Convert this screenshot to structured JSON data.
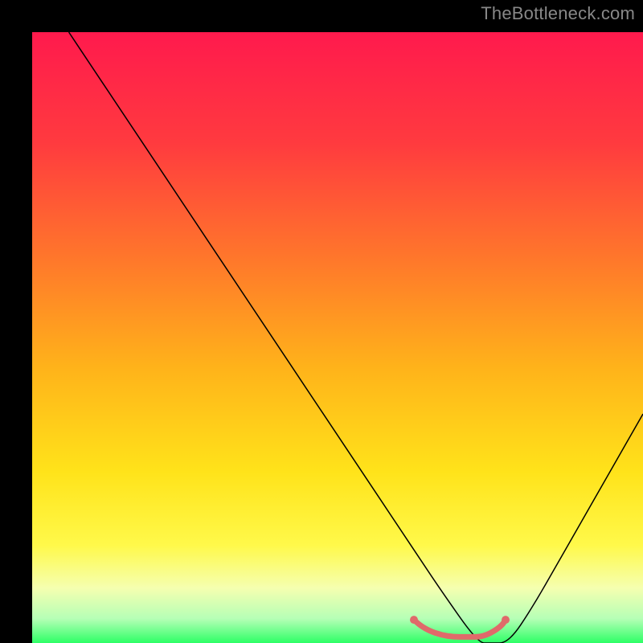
{
  "watermark": "TheBottleneck.com",
  "chart_data": {
    "type": "line",
    "title": "",
    "xlabel": "",
    "ylabel": "",
    "xlim": [
      0,
      100
    ],
    "ylim": [
      0,
      100
    ],
    "grid": false,
    "legend": false,
    "background_gradient_stops": [
      {
        "offset": 0.0,
        "color": "#ff1a4d"
      },
      {
        "offset": 0.18,
        "color": "#ff3a3f"
      },
      {
        "offset": 0.38,
        "color": "#ff7a2a"
      },
      {
        "offset": 0.55,
        "color": "#ffb31a"
      },
      {
        "offset": 0.72,
        "color": "#ffe31a"
      },
      {
        "offset": 0.84,
        "color": "#fff94a"
      },
      {
        "offset": 0.91,
        "color": "#f5ffb0"
      },
      {
        "offset": 0.96,
        "color": "#b6ffb6"
      },
      {
        "offset": 1.0,
        "color": "#2eff66"
      }
    ],
    "series": [
      {
        "name": "bottleneck-curve",
        "color": "#000000",
        "stroke_width": 1.5,
        "x": [
          6,
          10,
          15,
          20,
          25,
          30,
          35,
          40,
          45,
          50,
          55,
          60,
          63,
          67,
          73,
          75,
          78,
          82,
          86,
          90,
          94,
          100
        ],
        "y": [
          100,
          94,
          86.5,
          79,
          71.5,
          64,
          56.5,
          49,
          41.5,
          34,
          26.5,
          19,
          14.5,
          8.5,
          0,
          0,
          0,
          6,
          13,
          20,
          27,
          37.5
        ]
      }
    ],
    "highlight_segment": {
      "name": "optimal-range",
      "color": "#e06a6a",
      "stroke_width": 7,
      "endpoint_radius": 5,
      "x": [
        62.5,
        63.5,
        65,
        67,
        69,
        71,
        73,
        74,
        75,
        76,
        77,
        77.5
      ],
      "y": [
        3.8,
        2.9,
        2.0,
        1.3,
        1.0,
        1.0,
        1.0,
        1.2,
        1.6,
        2.2,
        3.0,
        3.8
      ]
    }
  }
}
